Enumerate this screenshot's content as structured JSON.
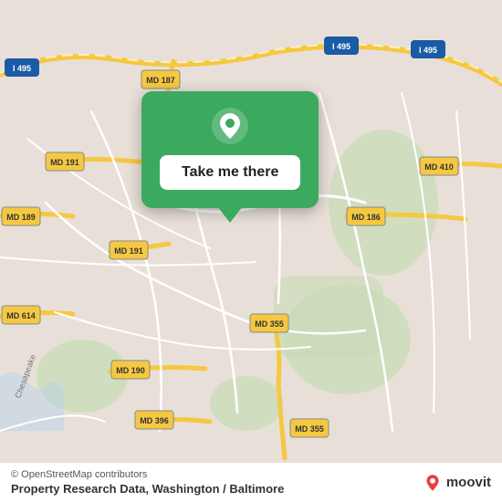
{
  "map": {
    "background_color": "#e8e0d8",
    "attribution": "© OpenStreetMap contributors",
    "title": "Property Research Data, Washington / Baltimore"
  },
  "popup": {
    "button_label": "Take me there",
    "pin_icon": "location-pin-icon"
  },
  "footer": {
    "copyright": "© OpenStreetMap contributors",
    "title": "Property Research Data, Washington / Baltimore",
    "logo_text": "moovit"
  },
  "road_labels": [
    {
      "id": "I-495-nw",
      "label": "I 495"
    },
    {
      "id": "MD-187",
      "label": "MD 187"
    },
    {
      "id": "I-495-ne",
      "label": "I 495"
    },
    {
      "id": "I-495-ne2",
      "label": "I 495"
    },
    {
      "id": "MD-410",
      "label": "MD 410"
    },
    {
      "id": "MD-191",
      "label": "MD 191"
    },
    {
      "id": "MD-191-2",
      "label": "MD 191"
    },
    {
      "id": "MD-186",
      "label": "MD 186"
    },
    {
      "id": "MD-189",
      "label": "MD 189"
    },
    {
      "id": "MD-614",
      "label": "MD 614"
    },
    {
      "id": "MD-190",
      "label": "MD 190"
    },
    {
      "id": "MD-355",
      "label": "MD 355"
    },
    {
      "id": "MD-355-2",
      "label": "MD 355"
    },
    {
      "id": "MD-396",
      "label": "MD 396"
    }
  ],
  "colors": {
    "map_bg": "#e8e0d8",
    "road_major": "#f5c842",
    "road_minor": "#ffffff",
    "green_area": "#c8dbb5",
    "popup_green": "#3baa5e",
    "popup_button_bg": "#ffffff",
    "accent_red": "#e84040"
  }
}
